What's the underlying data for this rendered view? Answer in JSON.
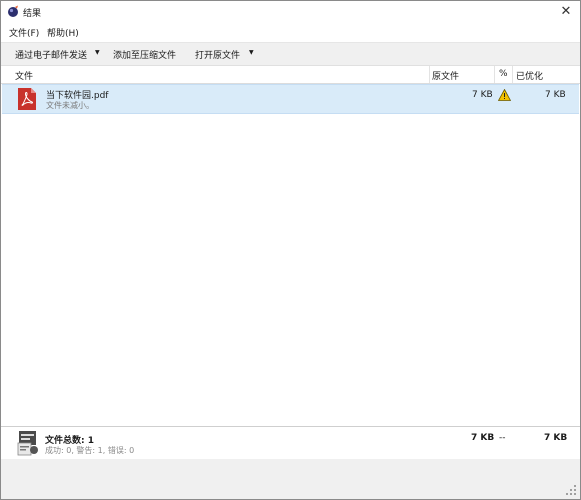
{
  "window": {
    "title": "结果",
    "close_glyph": "✕"
  },
  "menu": [
    "文件(F)",
    "帮助(H)"
  ],
  "toolbar": {
    "send_email": "通过电子邮件发送",
    "add_archive": "添加至压缩文件",
    "open_original": "打开原文件"
  },
  "columns": {
    "file": "文件",
    "original": "原文件",
    "percent": "%",
    "optimized": "已优化"
  },
  "rows": [
    {
      "name": "当下软件园.pdf",
      "status": "文件未减小。",
      "original": "7 KB",
      "optimized": "7 KB"
    }
  ],
  "summary": {
    "title": "文件总数: 1",
    "detail": "成功: 0, 警告: 1, 错误: 0",
    "original": "7 KB",
    "percent": "--",
    "optimized": "7 KB"
  },
  "colors": {
    "selection": "#d9ebf9",
    "pdf_red": "#c8322c",
    "warning_yellow": "#f2c200"
  },
  "icons": {
    "app": "app-orb-icon",
    "file": "pdf-file-icon",
    "warning": "warning-triangle-icon",
    "summary": "files-stack-icon"
  }
}
